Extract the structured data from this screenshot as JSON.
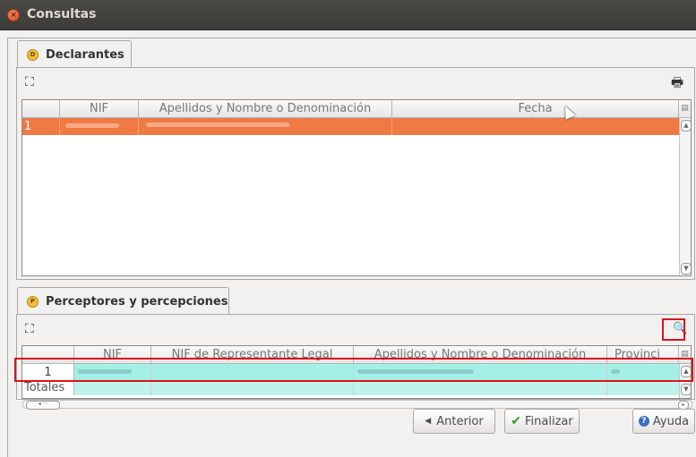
{
  "window": {
    "title": "Consultas"
  },
  "declarantes": {
    "tab_label": "Declarantes",
    "columns": [
      "",
      "NIF",
      "Apellidos y Nombre o Denominación",
      "Fecha"
    ],
    "rows": [
      {
        "num": "1"
      }
    ]
  },
  "perceptores": {
    "tab_label": "Perceptores y percepciones",
    "columns": [
      "",
      "NIF",
      "NIF de Representante Legal",
      "Apellidos y Nombre o Denominación",
      "Provinci"
    ],
    "rows": [
      {
        "num": "1"
      }
    ],
    "totals_label": "Totales"
  },
  "buttons": {
    "anterior": "Anterior",
    "finalizar": "Finalizar",
    "ayuda": "Ayuda"
  },
  "colors": {
    "selected_row": "#f07a44",
    "perceptor_row": "#a4efe6",
    "highlight": "#d9141b"
  }
}
